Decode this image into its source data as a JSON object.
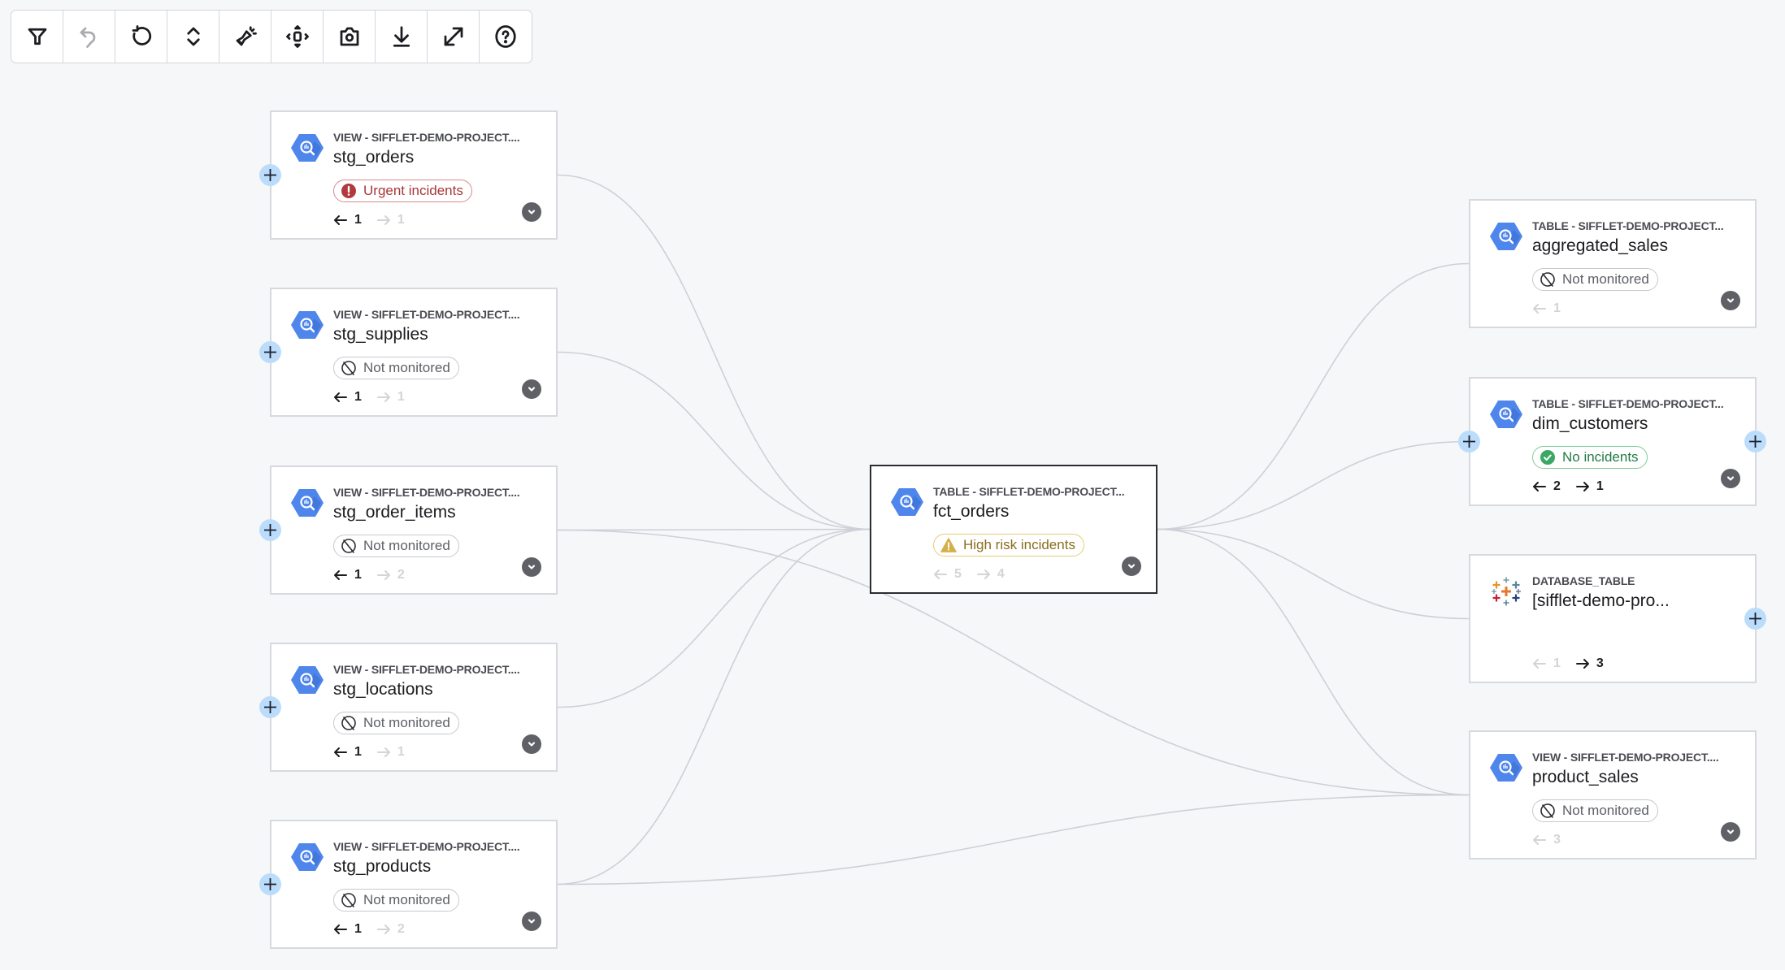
{
  "toolbar": {
    "buttons": [
      {
        "name": "filter",
        "icon": "filter-icon",
        "disabled": false
      },
      {
        "name": "undo",
        "icon": "undo-icon",
        "disabled": true
      },
      {
        "name": "reset",
        "icon": "reset-icon",
        "disabled": false
      },
      {
        "name": "expand-collapse",
        "icon": "expand-collapse-icon",
        "disabled": false
      },
      {
        "name": "highlight",
        "icon": "flashlight-icon",
        "disabled": false
      },
      {
        "name": "fit-view",
        "icon": "fit-view-icon",
        "disabled": false
      },
      {
        "name": "screenshot",
        "icon": "camera-icon",
        "disabled": false
      },
      {
        "name": "download",
        "icon": "download-icon",
        "disabled": false
      },
      {
        "name": "fullscreen",
        "icon": "fullscreen-icon",
        "disabled": false
      },
      {
        "name": "help",
        "icon": "help-icon",
        "disabled": false
      }
    ]
  },
  "colors": {
    "urgent": "#a8373a",
    "high_risk": "#d4b04a",
    "no_incidents": "#3aa864",
    "bigquery": "#4f86ec",
    "edge": "#cdd0d6"
  },
  "nodes": [
    {
      "id": "stg_orders",
      "type": "VIEW - SIFFLET-DEMO-PROJECT....",
      "name": "stg_orders",
      "source": "bigquery",
      "status": {
        "kind": "urgent",
        "label": "Urgent incidents"
      },
      "upstream": {
        "count": "1",
        "active": true
      },
      "downstream": {
        "count": "1",
        "active": false
      },
      "plus_left": true,
      "plus_right": false,
      "expand": true
    },
    {
      "id": "stg_supplies",
      "type": "VIEW - SIFFLET-DEMO-PROJECT....",
      "name": "stg_supplies",
      "source": "bigquery",
      "status": {
        "kind": "none",
        "label": "Not monitored"
      },
      "upstream": {
        "count": "1",
        "active": true
      },
      "downstream": {
        "count": "1",
        "active": false
      },
      "plus_left": true,
      "plus_right": false,
      "expand": true
    },
    {
      "id": "stg_order_items",
      "type": "VIEW - SIFFLET-DEMO-PROJECT....",
      "name": "stg_order_items",
      "source": "bigquery",
      "status": {
        "kind": "none",
        "label": "Not monitored"
      },
      "upstream": {
        "count": "1",
        "active": true
      },
      "downstream": {
        "count": "2",
        "active": false
      },
      "plus_left": true,
      "plus_right": false,
      "expand": true
    },
    {
      "id": "stg_locations",
      "type": "VIEW - SIFFLET-DEMO-PROJECT....",
      "name": "stg_locations",
      "source": "bigquery",
      "status": {
        "kind": "none",
        "label": "Not monitored"
      },
      "upstream": {
        "count": "1",
        "active": true
      },
      "downstream": {
        "count": "1",
        "active": false
      },
      "plus_left": true,
      "plus_right": false,
      "expand": true
    },
    {
      "id": "stg_products",
      "type": "VIEW - SIFFLET-DEMO-PROJECT....",
      "name": "stg_products",
      "source": "bigquery",
      "status": {
        "kind": "none",
        "label": "Not monitored"
      },
      "upstream": {
        "count": "1",
        "active": true
      },
      "downstream": {
        "count": "2",
        "active": false
      },
      "plus_left": true,
      "plus_right": false,
      "expand": true
    },
    {
      "id": "fct_orders",
      "type": "TABLE - SIFFLET-DEMO-PROJECT...",
      "name": "fct_orders",
      "source": "bigquery",
      "status": {
        "kind": "high",
        "label": "High risk incidents"
      },
      "upstream": {
        "count": "5",
        "active": false
      },
      "downstream": {
        "count": "4",
        "active": false
      },
      "plus_left": false,
      "plus_right": false,
      "expand": true,
      "selected": true
    },
    {
      "id": "aggregated_sales",
      "type": "TABLE - SIFFLET-DEMO-PROJECT...",
      "name": "aggregated_sales",
      "source": "bigquery",
      "status": {
        "kind": "none",
        "label": "Not monitored"
      },
      "upstream": {
        "count": "1",
        "active": false
      },
      "downstream": null,
      "plus_left": false,
      "plus_right": false,
      "expand": true
    },
    {
      "id": "dim_customers",
      "type": "TABLE - SIFFLET-DEMO-PROJECT...",
      "name": "dim_customers",
      "source": "bigquery",
      "status": {
        "kind": "ok",
        "label": "No incidents"
      },
      "upstream": {
        "count": "2",
        "active": true
      },
      "downstream": {
        "count": "1",
        "active": true
      },
      "plus_left": true,
      "plus_right": true,
      "expand": true
    },
    {
      "id": "database_table",
      "type": "DATABASE_TABLE",
      "name": "[sifflet-demo-pro...",
      "source": "tableau",
      "status": null,
      "upstream": {
        "count": "1",
        "active": false
      },
      "downstream": {
        "count": "3",
        "active": true
      },
      "plus_left": false,
      "plus_right": true,
      "expand": false
    },
    {
      "id": "product_sales",
      "type": "VIEW - SIFFLET-DEMO-PROJECT....",
      "name": "product_sales",
      "source": "bigquery",
      "status": {
        "kind": "none",
        "label": "Not monitored"
      },
      "upstream": {
        "count": "3",
        "active": false
      },
      "downstream": null,
      "plus_left": false,
      "plus_right": false,
      "expand": true
    }
  ],
  "edges": [
    [
      "stg_orders",
      "fct_orders"
    ],
    [
      "stg_supplies",
      "fct_orders"
    ],
    [
      "stg_order_items",
      "fct_orders"
    ],
    [
      "stg_order_items",
      "product_sales"
    ],
    [
      "stg_locations",
      "fct_orders"
    ],
    [
      "stg_products",
      "fct_orders"
    ],
    [
      "stg_products",
      "product_sales"
    ],
    [
      "fct_orders",
      "aggregated_sales"
    ],
    [
      "fct_orders",
      "dim_customers"
    ],
    [
      "fct_orders",
      "database_table"
    ],
    [
      "fct_orders",
      "product_sales"
    ]
  ]
}
